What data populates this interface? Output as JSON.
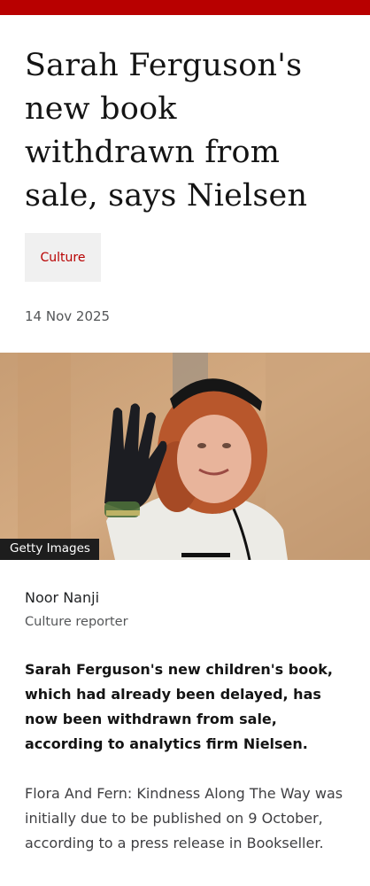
{
  "article": {
    "headline": "Sarah Ferguson's new book withdrawn from sale, says Nielsen",
    "tag": "Culture",
    "date": "14 Nov 2025",
    "image": {
      "credit": "Getty Images"
    },
    "byline": {
      "name": "Noor Nanji",
      "role": "Culture reporter"
    },
    "lead": "Sarah Ferguson's new children's book, which had already been delayed, has now been withdrawn from sale, according to analytics firm Nielsen.",
    "paragraphs": [
      "Flora And Fern: Kindness Along The Way was initially due to be published on 9 October, according to a press release in Bookseller."
    ]
  },
  "colors": {
    "brand_red": "#b80000",
    "tag_background": "#f0f0f0",
    "muted_text": "#545658"
  }
}
